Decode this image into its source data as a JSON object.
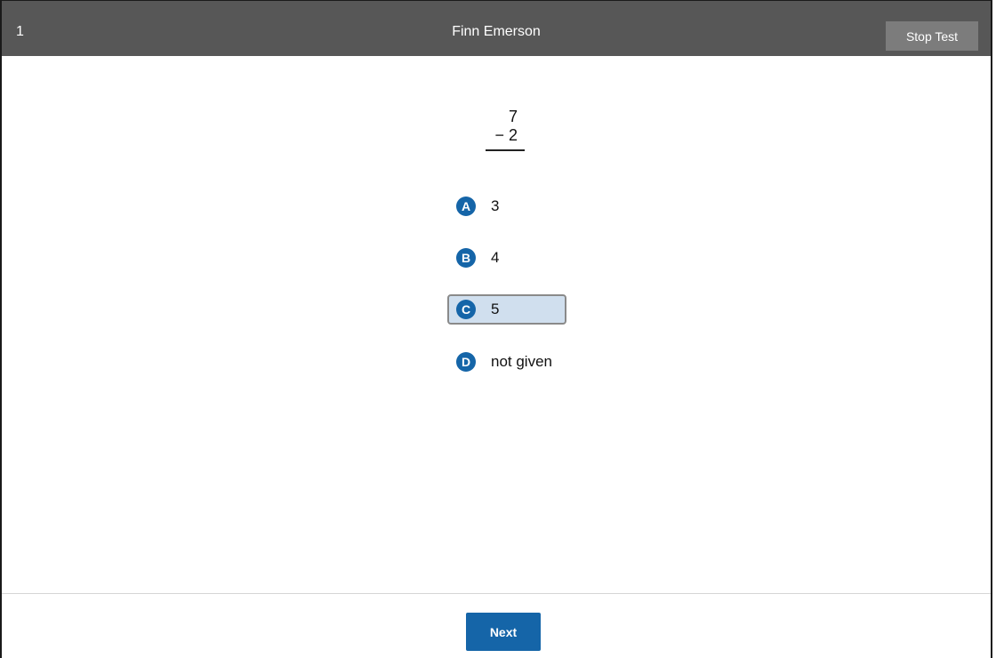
{
  "header": {
    "item_number": "1",
    "student_name": "Finn Emerson",
    "stop_label": "Stop Test"
  },
  "problem": {
    "top": "7",
    "bottom": "− 2",
    "operation": "subtraction"
  },
  "options": [
    {
      "letter": "A",
      "text": "3",
      "selected": false
    },
    {
      "letter": "B",
      "text": "4",
      "selected": false
    },
    {
      "letter": "C",
      "text": "5",
      "selected": true
    },
    {
      "letter": "D",
      "text": "not given",
      "selected": false
    }
  ],
  "footer": {
    "next_label": "Next"
  },
  "colors": {
    "header_bg": "#575757",
    "accent": "#1565a8",
    "selected_bg": "#d0dfee"
  }
}
